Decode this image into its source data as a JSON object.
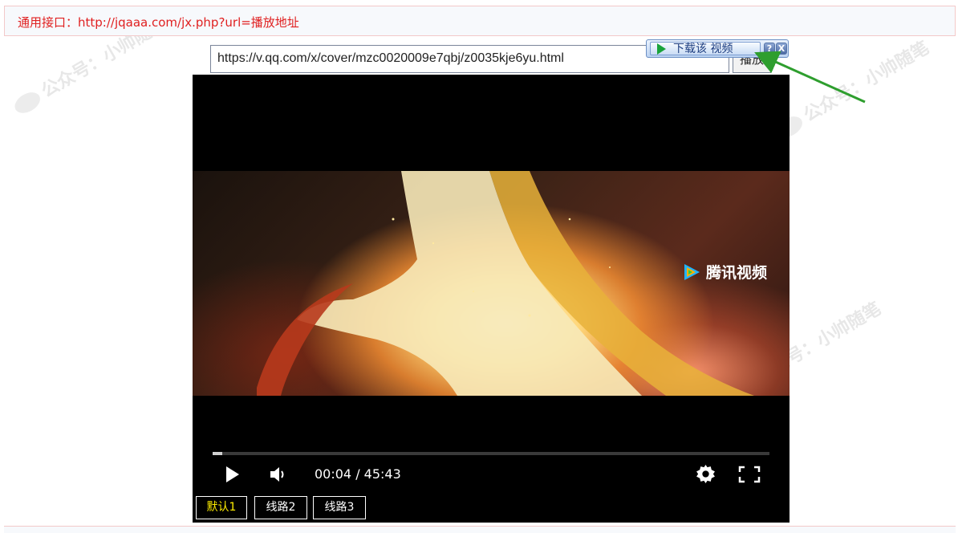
{
  "notice": {
    "text": "通用接口：http://jqaaa.com/jx.php?url=播放地址"
  },
  "url_bar": {
    "value": "https://v.qq.com/x/cover/mzc0020009e7qbj/z0035kje6yu.html",
    "play_label": "播放"
  },
  "download_toolbar": {
    "label": "下载该 视频",
    "help_label": "?",
    "close_label": "X"
  },
  "player": {
    "brand_text": "腾讯视频",
    "time_readout": "00:04 / 45:43",
    "progress": 0.0015,
    "routes": [
      {
        "label": "默认1",
        "active": true
      },
      {
        "label": "线路2",
        "active": false
      },
      {
        "label": "线路3",
        "active": false
      }
    ]
  },
  "watermark": {
    "text": "公众号：小帅随笔"
  },
  "colors": {
    "notice_text": "#e02020",
    "active_route": "#ffee00",
    "arrow": "#2e9e2e"
  },
  "icons": {
    "play": "play-icon",
    "volume": "volume-icon",
    "settings": "gear-icon",
    "fullscreen": "fullscreen-icon",
    "download": "play-triangle-icon",
    "help": "help-icon",
    "close": "close-icon",
    "brand": "tencent-video-logo"
  }
}
